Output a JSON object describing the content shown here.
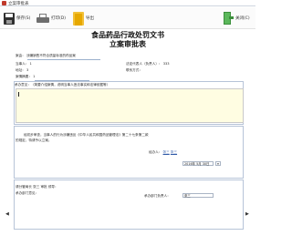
{
  "window": {
    "title": "立案审批表"
  },
  "toolbar": {
    "save_label": "保存(S)",
    "print_label": "打印(D)",
    "export_label": "导出",
    "return_label": "关闭(C)"
  },
  "document": {
    "title_line1": "食品药品行政处罚文书",
    "title_line2": "立案审批表"
  },
  "case": {
    "source_label": "案由：",
    "source_value": "涉嫌销售不符合质量标准的药品案",
    "party_label": "当事人：",
    "party_value": "1",
    "legal_rep_label": "法定代表人（负责人）：",
    "legal_rep_value": "333",
    "address_label": "地址：",
    "address_value": "3",
    "phone_label": "联系方式：",
    "phone_value": "",
    "brief_label": "案情摘要：",
    "brief_value": "1"
  },
  "suggestion": {
    "label": "承办意见：（简要介绍案情，说明当事人违法事实和法律依据等）",
    "content": ""
  },
  "handler": {
    "text_line1": "经初步审查，当事人的行为涉嫌违反《中华人民共和国药品管理法》第二十七条第二款",
    "text_line2": "的规定，特请予以立案。",
    "signer_label": "经办人：",
    "signer1": "张三",
    "signer2": "张三",
    "date_value": "2016年 5月 30日"
  },
  "review": {
    "label": "承办部门意见：",
    "reviewer_label": "承办部门负责人：",
    "reviewer_value": "张三",
    "note": "请分管局长 张三 审批 领导："
  },
  "nav": {
    "prev": "◀",
    "next": "▶"
  }
}
